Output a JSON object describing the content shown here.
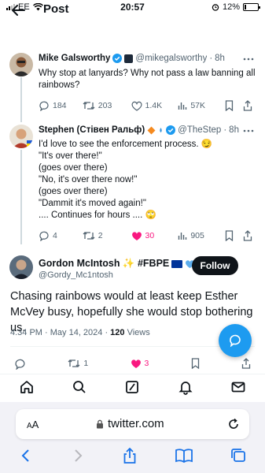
{
  "status_bar": {
    "carrier": "EE",
    "time": "20:57",
    "battery": "12%",
    "battery_level": 0.12
  },
  "header": {
    "title": "Post"
  },
  "parent_tweet": {
    "name": "Mike Galsworthy",
    "handle": "@mikegalsworthy",
    "time": "8h",
    "text": "Why stop at lanyards? Why not pass a law banning all rainbows?",
    "replies": "184",
    "reposts": "203",
    "likes": "1.4K",
    "views": "57K"
  },
  "reply_tweet": {
    "name": "Stephen (Стівен Ральф)",
    "handle": "@TheStep",
    "time": "8h",
    "lines": [
      "I'd love to see the enforcement process. 😏",
      "\"It's over there!\"",
      "(goes over there)",
      "\"No, it's over there now!\"",
      "(goes over there)",
      "\"Dammit it's moved again!\"",
      ".... Continues for hours .... 🙄"
    ],
    "replies": "4",
    "reposts": "2",
    "likes": "30",
    "views": "905"
  },
  "focus_tweet": {
    "name": "Gordon McIntosh ✨ #FBPE",
    "handle": "@Gordy_Mc1ntosh",
    "follow_label": "Follow",
    "text": "Chasing rainbows would at least keep Esther McVey busy, hopefully she would stop bothering us.",
    "timestamp": "4:34 PM · May 14, 2024 · ",
    "views_count": "120",
    "views_label": " Views",
    "reposts": "1",
    "likes": "3"
  },
  "safari": {
    "text_size_label": "A",
    "text_size_label_large": "A",
    "url": "twitter.com"
  },
  "colors": {
    "accent": "#1d9bf0",
    "like": "#f91880",
    "text": "#0f1419",
    "muted": "#536471"
  }
}
